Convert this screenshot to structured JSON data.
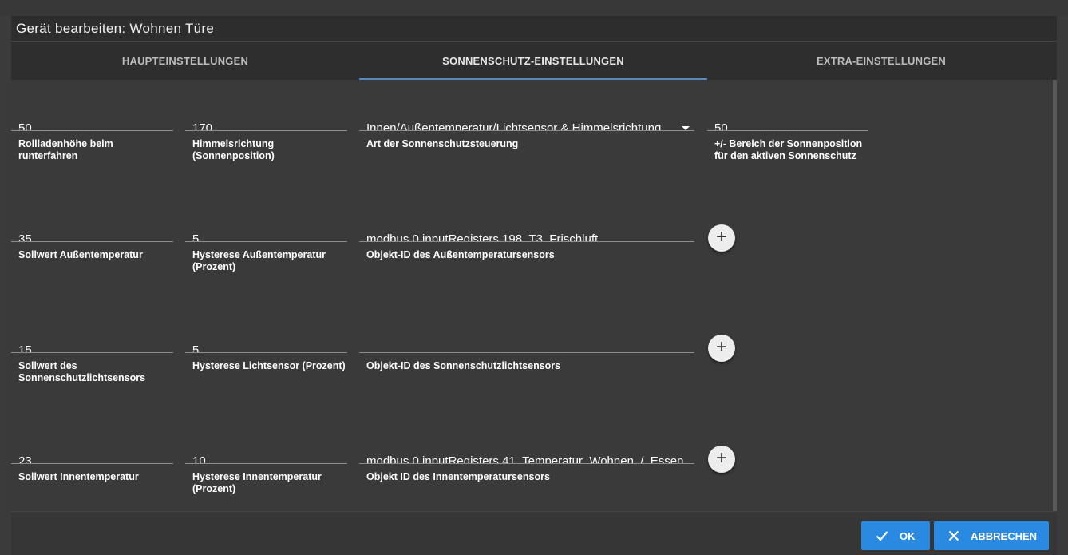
{
  "dialog": {
    "title": "Gerät bearbeiten: Wohnen Türe"
  },
  "tabs": [
    {
      "label": "HAUPTEINSTELLUNGEN",
      "active": false
    },
    {
      "label": "SONNENSCHUTZ-EINSTELLUNGEN",
      "active": true
    },
    {
      "label": "EXTRA-EINSTELLUNGEN",
      "active": false
    }
  ],
  "rows": [
    {
      "fields": [
        {
          "value": "50",
          "label": "Rollladenhöhe beim runterfahren"
        },
        {
          "value": "170",
          "label": "Himmelsrichtung (Sonnenposition)"
        },
        {
          "value": "Innen/Außentemperatur/Lichtsensor & Himmelsrichtung",
          "label": "Art der Sonnenschutzsteuerung"
        },
        {
          "value": "50",
          "label": "+/- Bereich der Sonnenposition für den aktiven Sonnenschutz"
        }
      ]
    },
    {
      "fields": [
        {
          "value": "35",
          "label": "Sollwert Außentemperatur"
        },
        {
          "value": "5",
          "label": "Hysterese Außentemperatur (Prozent)"
        },
        {
          "value": "modbus.0.inputRegisters.198_T3_Frischluft",
          "label": "Objekt-ID des Außentemperatursensors"
        }
      ]
    },
    {
      "fields": [
        {
          "value": "15",
          "label": "Sollwert des Sonnenschutzlichtsensors"
        },
        {
          "value": "5",
          "label": "Hysterese Lichtsensor (Prozent)"
        },
        {
          "value": "",
          "label": "Objekt-ID des Sonnenschutzlichtsensors"
        }
      ]
    },
    {
      "fields": [
        {
          "value": "23",
          "label": "Sollwert Innentemperatur"
        },
        {
          "value": "10",
          "label": "Hysterese Innentemperatur (Prozent)"
        },
        {
          "value": "modbus.0.inputRegisters.41_Temperatur_Wohnen_/_Essen",
          "label": "Objekt ID des Innentemperatursensors"
        }
      ]
    }
  ],
  "buttons": {
    "ok": "OK",
    "cancel": "ABBRECHEN"
  },
  "colors": {
    "accent": "#2a8ae2",
    "tab_indicator": "#5a87b8"
  }
}
